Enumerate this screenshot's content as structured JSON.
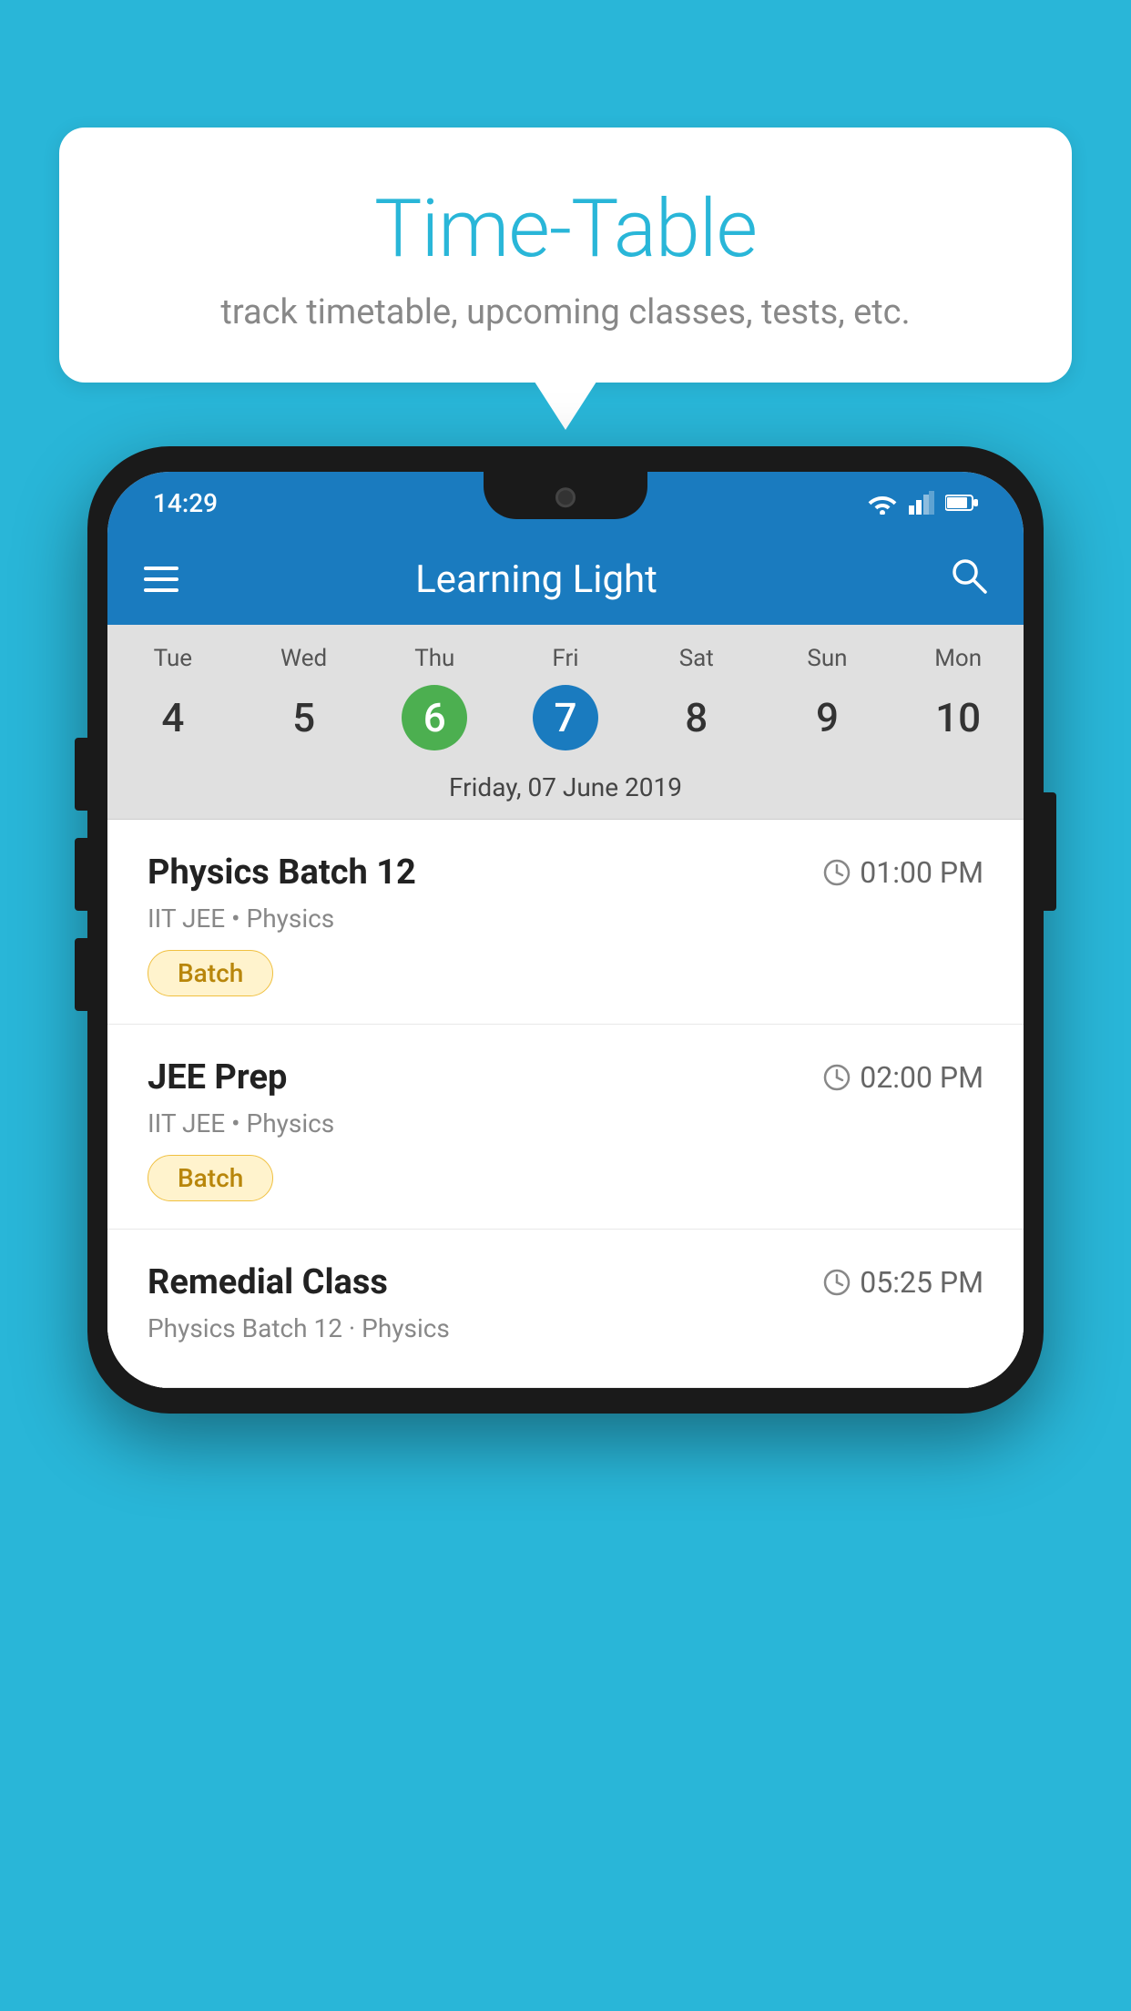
{
  "background_color": "#29b6d8",
  "speech_bubble": {
    "title": "Time-Table",
    "subtitle": "track timetable, upcoming classes, tests, etc."
  },
  "phone": {
    "status_bar": {
      "time": "14:29"
    },
    "app_bar": {
      "title": "Learning Light"
    },
    "calendar": {
      "days": [
        {
          "name": "Tue",
          "num": "4",
          "state": "normal"
        },
        {
          "name": "Wed",
          "num": "5",
          "state": "normal"
        },
        {
          "name": "Thu",
          "num": "6",
          "state": "today"
        },
        {
          "name": "Fri",
          "num": "7",
          "state": "selected"
        },
        {
          "name": "Sat",
          "num": "8",
          "state": "normal"
        },
        {
          "name": "Sun",
          "num": "9",
          "state": "normal"
        },
        {
          "name": "Mon",
          "num": "10",
          "state": "normal"
        }
      ],
      "selected_date_label": "Friday, 07 June 2019"
    },
    "schedule": [
      {
        "title": "Physics Batch 12",
        "time": "01:00 PM",
        "subtitle": "IIT JEE • Physics",
        "tag": "Batch"
      },
      {
        "title": "JEE Prep",
        "time": "02:00 PM",
        "subtitle": "IIT JEE • Physics",
        "tag": "Batch"
      },
      {
        "title": "Remedial Class",
        "time": "05:25 PM",
        "subtitle": "Physics Batch 12 · Physics",
        "tag": null
      }
    ]
  }
}
